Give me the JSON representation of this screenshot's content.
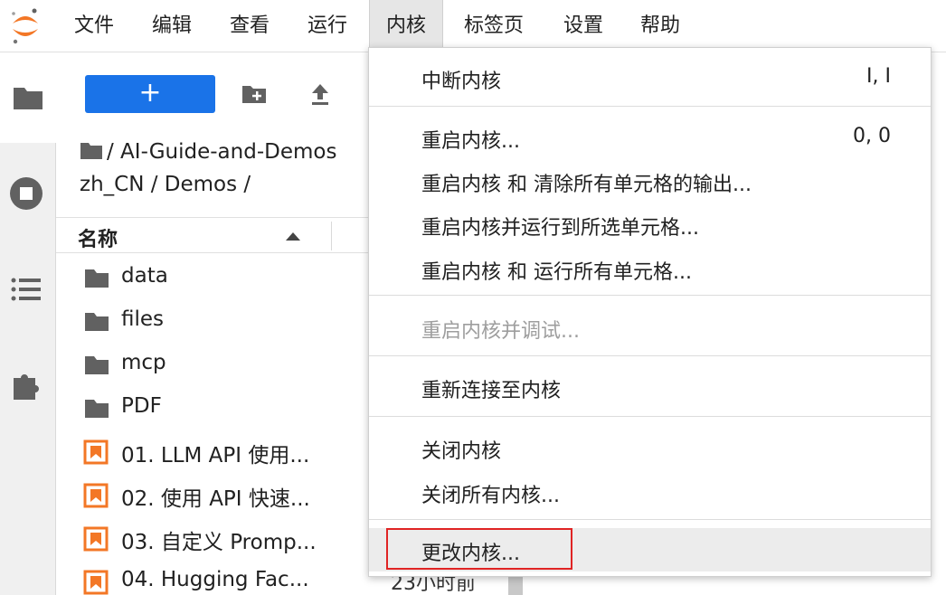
{
  "menubar": {
    "items": [
      "文件",
      "编辑",
      "查看",
      "运行",
      "内核",
      "标签页",
      "设置",
      "帮助"
    ],
    "active": "内核"
  },
  "filebrowser": {
    "new_button_label": "+",
    "breadcrumb": "/ AI-Guide-and-Demos zh_CN / Demos /",
    "column_name": "名称",
    "rows": [
      {
        "type": "folder",
        "name": "data"
      },
      {
        "type": "folder",
        "name": "files"
      },
      {
        "type": "folder",
        "name": "mcp"
      },
      {
        "type": "folder",
        "name": "PDF"
      },
      {
        "type": "notebook",
        "name": "01. LLM API 使用..."
      },
      {
        "type": "notebook",
        "name": "02. 使用 API 快速..."
      },
      {
        "type": "notebook",
        "name": "03. 自定义 Promp..."
      },
      {
        "type": "notebook",
        "name": "04. Hugging Fac..."
      }
    ],
    "last_row_time": "23小时前"
  },
  "dropdown": {
    "items": [
      {
        "label": "中断内核",
        "shortcut": "I, I",
        "disabled": false
      },
      {
        "label": "重启内核...",
        "shortcut": "0, 0",
        "disabled": false
      },
      {
        "label": "重启内核 和 清除所有单元格的输出...",
        "shortcut": "",
        "disabled": false
      },
      {
        "label": "重启内核并运行到所选单元格...",
        "shortcut": "",
        "disabled": false
      },
      {
        "label": "重启内核 和 运行所有单元格...",
        "shortcut": "",
        "disabled": false
      },
      {
        "label": "重启内核并调试...",
        "shortcut": "",
        "disabled": true
      },
      {
        "label": "重新连接至内核",
        "shortcut": "",
        "disabled": false
      },
      {
        "label": "关闭内核",
        "shortcut": "",
        "disabled": false
      },
      {
        "label": "关闭所有内核...",
        "shortcut": "",
        "disabled": false
      },
      {
        "label": "更改内核...",
        "shortcut": "",
        "disabled": false,
        "hover": true
      }
    ]
  },
  "colors": {
    "accent": "#1a73e8",
    "logo_orange": "#f37726",
    "highlight_red": "#e02424",
    "disabled_text": "#9e9e9e"
  },
  "icons": [
    "jupyter-logo-icon",
    "folder-icon",
    "stop-circle-icon",
    "list-icon",
    "puzzle-icon",
    "new-folder-icon",
    "upload-icon",
    "notebook-icon"
  ]
}
